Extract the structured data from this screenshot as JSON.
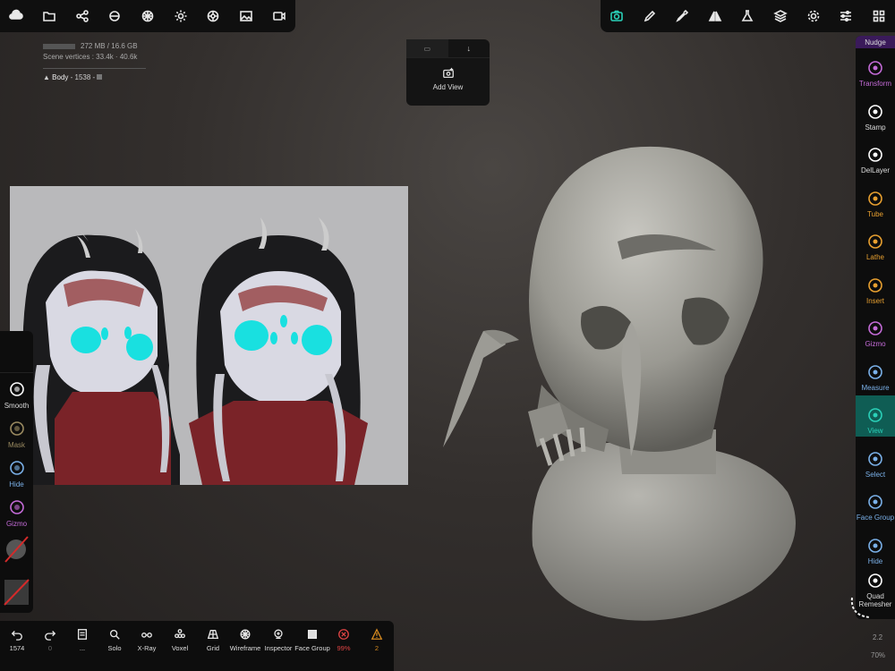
{
  "top_left_toolbar": {
    "icons": [
      "cloud-icon",
      "folder-icon",
      "share-icon",
      "paint-brush-icon",
      "sphere-grid-icon",
      "sun-icon",
      "material-icon",
      "image-icon",
      "video-icon"
    ]
  },
  "top_right_toolbar": {
    "icons": [
      "camera-icon",
      "pencil-icon",
      "dropper-icon",
      "symmetry-icon",
      "flask-icon",
      "layers-icon",
      "settings-icon",
      "sliders-icon",
      "menu-grid-icon"
    ]
  },
  "stats": {
    "memory": "272 MB / 16.6 GB",
    "vertices_label": "Scene vertices : 33.4k · ",
    "vertices_extra": "40.6k",
    "object": "Body",
    "object_detail": "- 1538 -"
  },
  "view_popup": {
    "add_view_label": "Add View"
  },
  "right_sidebar": {
    "nudge_label": "Nudge",
    "items": [
      {
        "label": "Transform",
        "color": "#c46bd8"
      },
      {
        "label": "Stamp",
        "color": "#ffffff"
      },
      {
        "label": "DelLayer",
        "color": "#ffffff"
      },
      {
        "label": "Tube",
        "color": "#e8a030"
      },
      {
        "label": "Lathe",
        "color": "#e8a030"
      },
      {
        "label": "Insert",
        "color": "#e8a030"
      },
      {
        "label": "Gizmo",
        "color": "#c46bd8"
      },
      {
        "label": "Measure",
        "color": "#7ab0e8"
      },
      {
        "label": "View",
        "color": "#2ad0b8"
      },
      {
        "label": "Select",
        "color": "#7ab0e8"
      },
      {
        "label": "Face Group",
        "color": "#7ab0e8"
      },
      {
        "label": "Hide",
        "color": "#7ab0e8"
      },
      {
        "label": "Quad Remesher",
        "color": "#ffffff"
      }
    ],
    "version": "2.2",
    "zoom": "70%"
  },
  "left_sidebar": {
    "items": [
      {
        "label": "Smooth",
        "color": "#ffffff"
      },
      {
        "label": "Mask",
        "color": "#9a8a60"
      },
      {
        "label": "Hide",
        "color": "#7ab0e8"
      },
      {
        "label": "Gizmo",
        "color": "#c46bd8"
      }
    ]
  },
  "bottom_bar": {
    "items": [
      {
        "label": "1574",
        "icon": "undo-icon"
      },
      {
        "label": "0",
        "icon": "redo-icon"
      },
      {
        "label": "...",
        "icon": "scene-icon"
      },
      {
        "label": "Solo",
        "icon": "magnifier-icon"
      },
      {
        "label": "X-Ray",
        "icon": "glasses-icon"
      },
      {
        "label": "Voxel",
        "icon": "voxel-icon"
      },
      {
        "label": "Grid",
        "icon": "grid-icon"
      },
      {
        "label": "Wireframe",
        "icon": "wireframe-icon"
      },
      {
        "label": "Inspector",
        "icon": "inspector-icon"
      },
      {
        "label": "Face Group",
        "icon": "facegroup-icon"
      },
      {
        "label": "99%",
        "icon": "error-icon"
      },
      {
        "label": "2",
        "icon": "warning-icon"
      }
    ]
  }
}
